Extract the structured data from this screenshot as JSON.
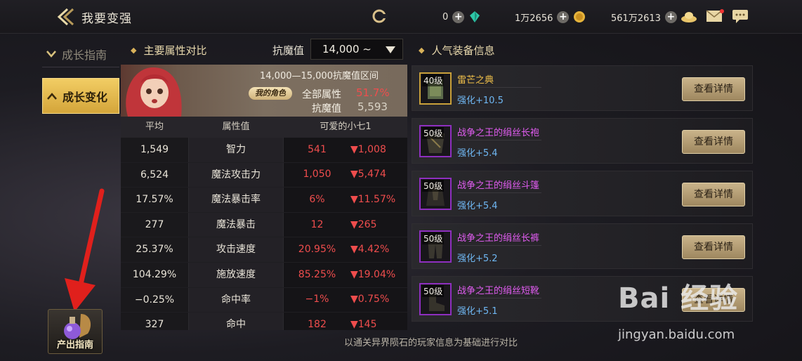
{
  "header": {
    "title": "我要变强",
    "currency": [
      {
        "value": "0",
        "icon": "crystal-icon"
      },
      {
        "value": "1万2656",
        "icon": "gold-coin-icon"
      },
      {
        "value": "561万2613",
        "icon": "gold-ingot-icon"
      }
    ]
  },
  "nav": {
    "items": [
      {
        "label": "成长指南",
        "active": false
      },
      {
        "label": "成长变化",
        "active": true
      }
    ],
    "guide_button": "产出指南"
  },
  "compare": {
    "title": "主要属性对比",
    "resist_label": "抗魔值",
    "resist_select": "14,000 ~",
    "range_text": "14,000—15,000抗魔值区间",
    "my_role": "我的角色",
    "all_attr_label": "全部属性",
    "all_attr_value": "51.7%",
    "resist_value_label": "抗魔值",
    "resist_value": "5,593",
    "columns": [
      "平均",
      "属性值",
      "可爱的小七1"
    ],
    "rows": [
      {
        "avg": "1,549",
        "attr": "智力",
        "mine": "541",
        "diff": "▼1,008"
      },
      {
        "avg": "6,524",
        "attr": "魔法攻击力",
        "mine": "1,050",
        "diff": "▼5,474"
      },
      {
        "avg": "17.57%",
        "attr": "魔法暴击率",
        "mine": "6%",
        "diff": "▼11.57%"
      },
      {
        "avg": "277",
        "attr": "魔法暴击",
        "mine": "12",
        "diff": "▼265"
      },
      {
        "avg": "25.37%",
        "attr": "攻击速度",
        "mine": "20.95%",
        "diff": "▼4.42%"
      },
      {
        "avg": "104.29%",
        "attr": "施放速度",
        "mine": "85.25%",
        "diff": "▼19.04%"
      },
      {
        "avg": "−0.25%",
        "attr": "命中率",
        "mine": "−1%",
        "diff": "▼0.75%"
      },
      {
        "avg": "327",
        "attr": "命中",
        "mine": "182",
        "diff": "▼145"
      }
    ],
    "footnote": "以通关异界陨石的玩家信息为基础进行对比"
  },
  "equipment": {
    "title": "人气装备信息",
    "detail_label": "查看详情",
    "items": [
      {
        "level": "40级",
        "name": "雷芒之典",
        "enhance": "强化+10.5",
        "color": "#f2c14a"
      },
      {
        "level": "50级",
        "name": "战争之王的绢丝长袍",
        "enhance": "强化+5.4",
        "color": "#e05cf0"
      },
      {
        "level": "50级",
        "name": "战争之王的绢丝斗篷",
        "enhance": "强化+5.4",
        "color": "#e05cf0"
      },
      {
        "level": "50级",
        "name": "战争之王的绢丝长裤",
        "enhance": "强化+5.2",
        "color": "#e05cf0"
      },
      {
        "level": "50级",
        "name": "战争之王的绢丝短靴",
        "enhance": "强化+5.1",
        "color": "#e05cf0"
      }
    ]
  },
  "watermark": {
    "text": "Bai 经验",
    "url": "jingyan.baidu.com"
  },
  "colors": {
    "accent_gold": "#e9c25a",
    "down_red": "#ef4d4d",
    "enhance_blue": "#6fb7f3",
    "epic_purple": "#e05cf0"
  }
}
